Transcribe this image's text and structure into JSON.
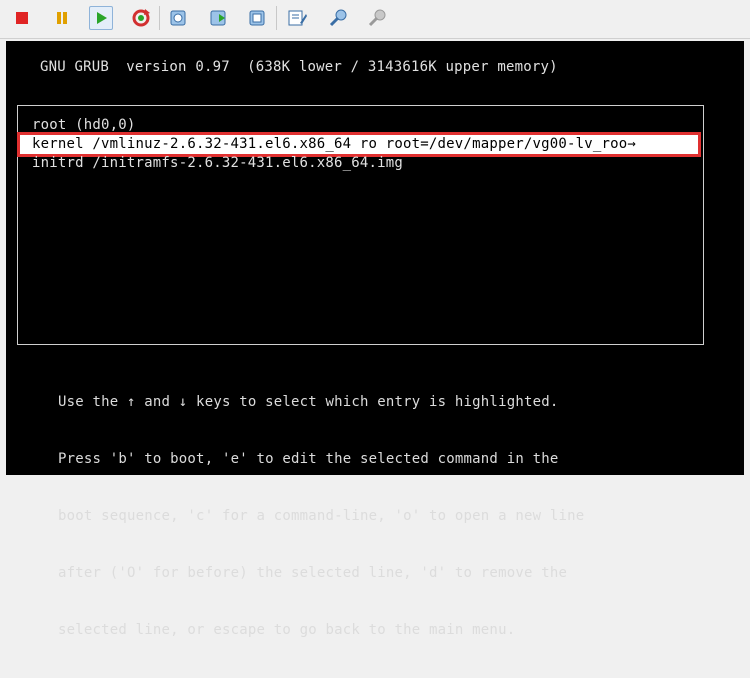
{
  "toolbar": {
    "buttons": [
      {
        "name": "stop-button",
        "icon": "stop-icon",
        "color": "#e02424"
      },
      {
        "name": "pause-button",
        "icon": "pause-icon",
        "color": "#e0a000"
      },
      {
        "name": "start-button",
        "icon": "play-icon",
        "color": "#2aa52a"
      },
      {
        "name": "reset-button",
        "icon": "reset-icon",
        "color": "#d23030"
      },
      {
        "name": "snapshot-take-button",
        "icon": "snapshot-icon"
      },
      {
        "name": "snapshot-revert-button",
        "icon": "snapshot-revert-icon"
      },
      {
        "name": "snapshot-manager-button",
        "icon": "snapshot-manager-icon"
      },
      {
        "name": "edit-settings-button",
        "icon": "edit-settings-icon"
      },
      {
        "name": "tools-button",
        "icon": "tools-icon"
      },
      {
        "name": "disabled-button",
        "icon": "wrench-disabled-icon"
      }
    ]
  },
  "grub": {
    "header": "GNU GRUB  version 0.97  (638K lower / 3143616K upper memory)",
    "entries": [
      "root (hd0,0)",
      "kernel /vmlinuz-2.6.32-431.el6.x86_64 ro root=/dev/mapper/vg00-lv_roo→",
      "initrd /initramfs-2.6.32-431.el6.x86_64.img"
    ],
    "selected_index": 1,
    "help": [
      "Use the ↑ and ↓ keys to select which entry is highlighted.",
      "Press 'b' to boot, 'e' to edit the selected command in the",
      "boot sequence, 'c' for a command-line, 'o' to open a new line",
      "after ('O' for before) the selected line, 'd' to remove the",
      "selected line, or escape to go back to the main menu."
    ]
  },
  "colors": {
    "highlight_outline": "#e03030",
    "screen_bg": "#000000"
  }
}
